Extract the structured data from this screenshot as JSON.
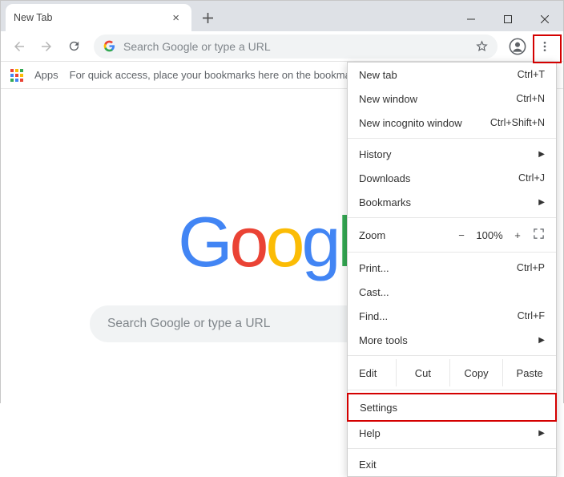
{
  "tabstrip": {
    "tab_title": "New Tab"
  },
  "toolbar": {
    "omnibox_placeholder": "Search Google or type a URL"
  },
  "bookmarks_bar": {
    "apps_label": "Apps",
    "hint": "For quick access, place your bookmarks here on the bookmarks ba"
  },
  "content": {
    "search_placeholder": "Search Google or type a URL"
  },
  "menu": {
    "new_tab": {
      "label": "New tab",
      "shortcut": "Ctrl+T"
    },
    "new_window": {
      "label": "New window",
      "shortcut": "Ctrl+N"
    },
    "new_incognito": {
      "label": "New incognito window",
      "shortcut": "Ctrl+Shift+N"
    },
    "history": {
      "label": "History"
    },
    "downloads": {
      "label": "Downloads",
      "shortcut": "Ctrl+J"
    },
    "bookmarks": {
      "label": "Bookmarks"
    },
    "zoom": {
      "label": "Zoom",
      "minus": "−",
      "value": "100%",
      "plus": "+"
    },
    "print": {
      "label": "Print...",
      "shortcut": "Ctrl+P"
    },
    "cast": {
      "label": "Cast..."
    },
    "find": {
      "label": "Find...",
      "shortcut": "Ctrl+F"
    },
    "more_tools": {
      "label": "More tools"
    },
    "edit": {
      "label": "Edit",
      "cut": "Cut",
      "copy": "Copy",
      "paste": "Paste"
    },
    "settings": {
      "label": "Settings"
    },
    "help": {
      "label": "Help"
    },
    "exit": {
      "label": "Exit"
    }
  }
}
